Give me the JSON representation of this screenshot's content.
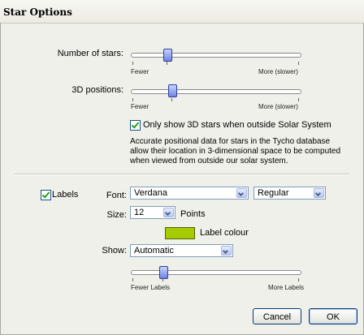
{
  "window": {
    "title": "Star Options"
  },
  "stars": {
    "number_label": "Number of stars:",
    "number_slider": {
      "min_label": "Fewer",
      "max_label": "More (slower)",
      "level": 0.2
    },
    "positions_label": "3D positions:",
    "positions_slider": {
      "min_label": "Fewer",
      "max_label": "More (slower)",
      "level": 0.24
    },
    "only3d_checkbox": {
      "checked": true,
      "label": "Only show 3D stars when outside Solar System"
    },
    "description": "Accurate positional data for stars in the Tycho database allow their location in 3-dimensional space to be computed when viewed from outside our solar system."
  },
  "labels": {
    "checkbox": {
      "checked": true,
      "label": "Labels"
    },
    "font_label": "Font:",
    "font_value": "Verdana",
    "style_value": "Regular",
    "size_label": "Size:",
    "size_value": "12",
    "size_unit": "Points",
    "colour_label": "Label colour",
    "colour": "#a6cb00",
    "show_label": "Show:",
    "show_value": "Automatic",
    "labels_slider": {
      "min_label": "Fewer Labels",
      "max_label": "More Labels",
      "level": 0.18
    }
  },
  "buttons": {
    "cancel": "Cancel",
    "ok": "OK"
  }
}
